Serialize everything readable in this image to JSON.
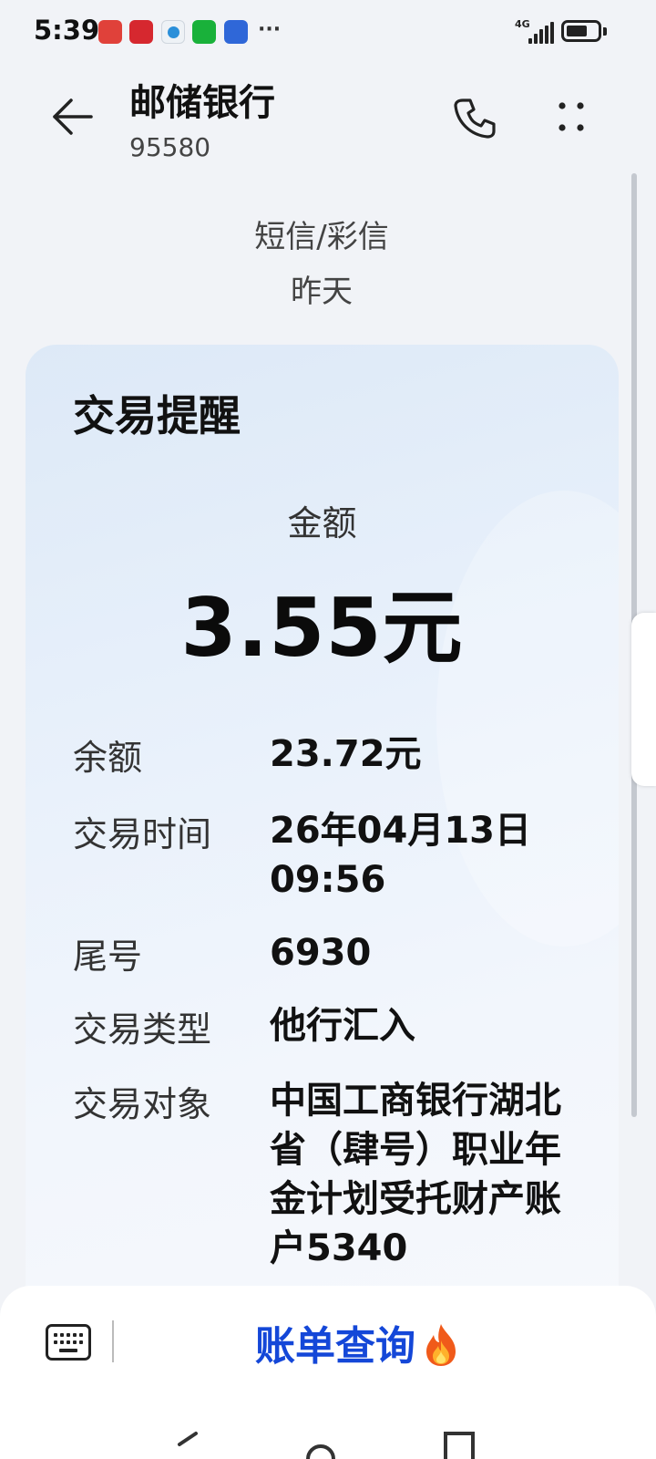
{
  "status_bar": {
    "time": "5:39",
    "network": "4G",
    "more": "···"
  },
  "header": {
    "contact_name": "邮储银行",
    "contact_number": "95580"
  },
  "meta": {
    "message_type": "短信/彩信",
    "date": "昨天"
  },
  "card": {
    "title": "交易提醒",
    "amount_label": "金额",
    "amount_value": "3.55元",
    "rows": [
      {
        "label": "余额",
        "value": "23.72元"
      },
      {
        "label": "交易时间",
        "value": "26年04月13日\n09:56"
      },
      {
        "label": "尾号",
        "value": "6930"
      },
      {
        "label": "交易类型",
        "value": "他行汇入"
      },
      {
        "label": "交易对象",
        "value": "中国工商银行湖北省（肆号）职业年金计划受托财产账户5340"
      }
    ]
  },
  "bottom_bar": {
    "bill_label": "账单查询"
  },
  "colors": {
    "accent": "#1447d8",
    "card_bg": "#e9f1fb",
    "page_bg": "#f1f3f7"
  },
  "icons": [
    "back-arrow-icon",
    "phone-icon",
    "more-icon",
    "keyboard-icon",
    "fire-icon"
  ]
}
